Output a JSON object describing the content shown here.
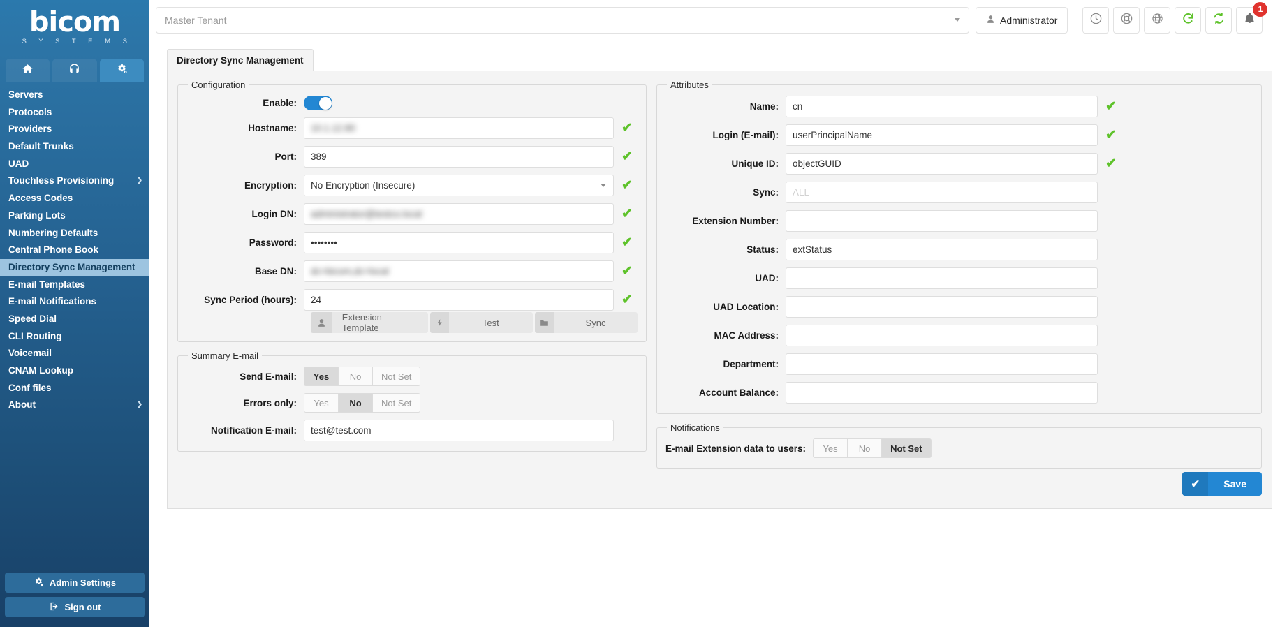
{
  "brand": {
    "name": "bicom",
    "tagline": "S Y S T E M S"
  },
  "nav_tabs": [
    {
      "icon": "home-icon",
      "name": "tab-home"
    },
    {
      "icon": "headset-icon",
      "name": "tab-support"
    },
    {
      "icon": "gears-icon",
      "name": "tab-settings",
      "active": true
    }
  ],
  "sidebar": {
    "items": [
      {
        "label": "Servers",
        "active": false,
        "expandable": false
      },
      {
        "label": "Protocols",
        "active": false,
        "expandable": false
      },
      {
        "label": "Providers",
        "active": false,
        "expandable": false
      },
      {
        "label": "Default Trunks",
        "active": false,
        "expandable": false
      },
      {
        "label": "UAD",
        "active": false,
        "expandable": false
      },
      {
        "label": "Touchless Provisioning",
        "active": false,
        "expandable": true
      },
      {
        "label": "Access Codes",
        "active": false,
        "expandable": false
      },
      {
        "label": "Parking Lots",
        "active": false,
        "expandable": false
      },
      {
        "label": "Numbering Defaults",
        "active": false,
        "expandable": false
      },
      {
        "label": "Central Phone Book",
        "active": false,
        "expandable": false
      },
      {
        "label": "Directory Sync Management",
        "active": true,
        "expandable": false
      },
      {
        "label": "E-mail Templates",
        "active": false,
        "expandable": false
      },
      {
        "label": "E-mail Notifications",
        "active": false,
        "expandable": false
      },
      {
        "label": "Speed Dial",
        "active": false,
        "expandable": false
      },
      {
        "label": "CLI Routing",
        "active": false,
        "expandable": false
      },
      {
        "label": "Voicemail",
        "active": false,
        "expandable": false
      },
      {
        "label": "CNAM Lookup",
        "active": false,
        "expandable": false
      },
      {
        "label": "Conf files",
        "active": false,
        "expandable": false
      },
      {
        "label": "About",
        "active": false,
        "expandable": true
      }
    ],
    "admin_settings_label": "Admin Settings",
    "sign_out_label": "Sign out"
  },
  "topbar": {
    "tenant_value": "Master Tenant",
    "admin_label": "Administrator",
    "icons": [
      {
        "name": "clock-icon"
      },
      {
        "name": "life-ring-icon"
      },
      {
        "name": "globe-icon"
      },
      {
        "name": "reload-icon"
      },
      {
        "name": "sync-icon"
      },
      {
        "name": "bell-icon"
      }
    ],
    "notification_count": "1"
  },
  "page": {
    "tab_label": "Directory Sync Management"
  },
  "configuration": {
    "legend": "Configuration",
    "enable_label": "Enable:",
    "enable_on": true,
    "fields": [
      {
        "label": "Hostname:",
        "value": "10.1.12.80",
        "blurred": true,
        "valid": true
      },
      {
        "label": "Port:",
        "value": "389",
        "blurred": false,
        "valid": true
      },
      {
        "label": "Encryption:",
        "value": "No Encryption (Insecure)",
        "blurred": false,
        "valid": true,
        "select": true
      },
      {
        "label": "Login DN:",
        "value": "administrator@testco.local",
        "blurred": true,
        "valid": true
      },
      {
        "label": "Password:",
        "value": "••••••••",
        "blurred": false,
        "valid": true
      },
      {
        "label": "Base DN:",
        "value": "dc=bicom,dc=local",
        "blurred": true,
        "valid": true
      },
      {
        "label": "Sync Period (hours):",
        "value": "24",
        "blurred": false,
        "valid": true
      }
    ],
    "buttons": [
      {
        "label": "Extension Template",
        "icon": "user-icon"
      },
      {
        "label": "Test",
        "icon": "bolt-icon"
      },
      {
        "label": "Sync",
        "icon": "folder-icon"
      }
    ]
  },
  "summary_email": {
    "legend": "Summary E-mail",
    "send_email": {
      "label": "Send E-mail:",
      "options": [
        "Yes",
        "No",
        "Not Set"
      ],
      "selected": "Yes"
    },
    "errors_only": {
      "label": "Errors only:",
      "options": [
        "Yes",
        "No",
        "Not Set"
      ],
      "selected": "No"
    },
    "notification_email": {
      "label": "Notification E-mail:",
      "value": "test@test.com"
    }
  },
  "attributes": {
    "legend": "Attributes",
    "fields": [
      {
        "label": "Name:",
        "value": "cn",
        "placeholder": "",
        "valid": true
      },
      {
        "label": "Login (E-mail):",
        "value": "userPrincipalName",
        "placeholder": "",
        "valid": true
      },
      {
        "label": "Unique ID:",
        "value": "objectGUID",
        "placeholder": "",
        "valid": true
      },
      {
        "label": "Sync:",
        "value": "",
        "placeholder": "ALL",
        "valid": false
      },
      {
        "label": "Extension Number:",
        "value": "",
        "placeholder": "",
        "valid": false
      },
      {
        "label": "Status:",
        "value": "extStatus",
        "placeholder": "",
        "valid": false
      },
      {
        "label": "UAD:",
        "value": "",
        "placeholder": "",
        "valid": false
      },
      {
        "label": "UAD Location:",
        "value": "",
        "placeholder": "",
        "valid": false
      },
      {
        "label": "MAC Address:",
        "value": "",
        "placeholder": "",
        "valid": false
      },
      {
        "label": "Department:",
        "value": "",
        "placeholder": "",
        "valid": false
      },
      {
        "label": "Account Balance:",
        "value": "",
        "placeholder": "",
        "valid": false
      }
    ]
  },
  "notifications": {
    "legend": "Notifications",
    "email_extension_data": {
      "label": "E-mail Extension data to users:",
      "options": [
        "Yes",
        "No",
        "Not Set"
      ],
      "selected": "Not Set"
    }
  },
  "save": {
    "label": "Save",
    "icon": "check-icon"
  },
  "colors": {
    "brand_blue": "#2387d3",
    "sidebar_top": "#2b79ad",
    "sidebar_bottom": "#184067",
    "valid_green": "#5ec22a",
    "badge_red": "#e0332e",
    "active_item_bg": "#9dc4e0"
  }
}
